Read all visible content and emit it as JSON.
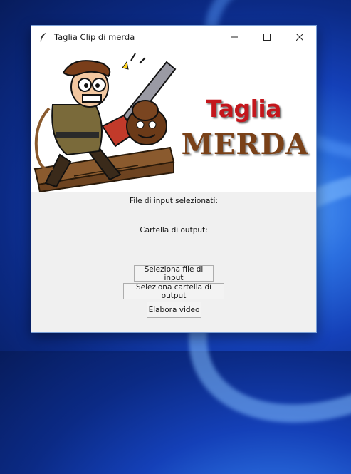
{
  "window": {
    "title": "Taglia Clip di merda"
  },
  "titlebar_icons": {
    "app": "feather-icon",
    "minimize": "minimize-icon",
    "maximize": "maximize-icon",
    "close": "close-icon"
  },
  "banner": {
    "line1": "Taglia",
    "line2": "MERDA",
    "line1_color": "#c4161c",
    "line2_color": "#7a4118"
  },
  "labels": {
    "input_files": "File di input selezionati:",
    "output_folder": "Cartella di output:"
  },
  "buttons": {
    "select_input": "Seleziona file di input",
    "select_output": "Seleziona cartella di output",
    "process": "Elabora video"
  }
}
